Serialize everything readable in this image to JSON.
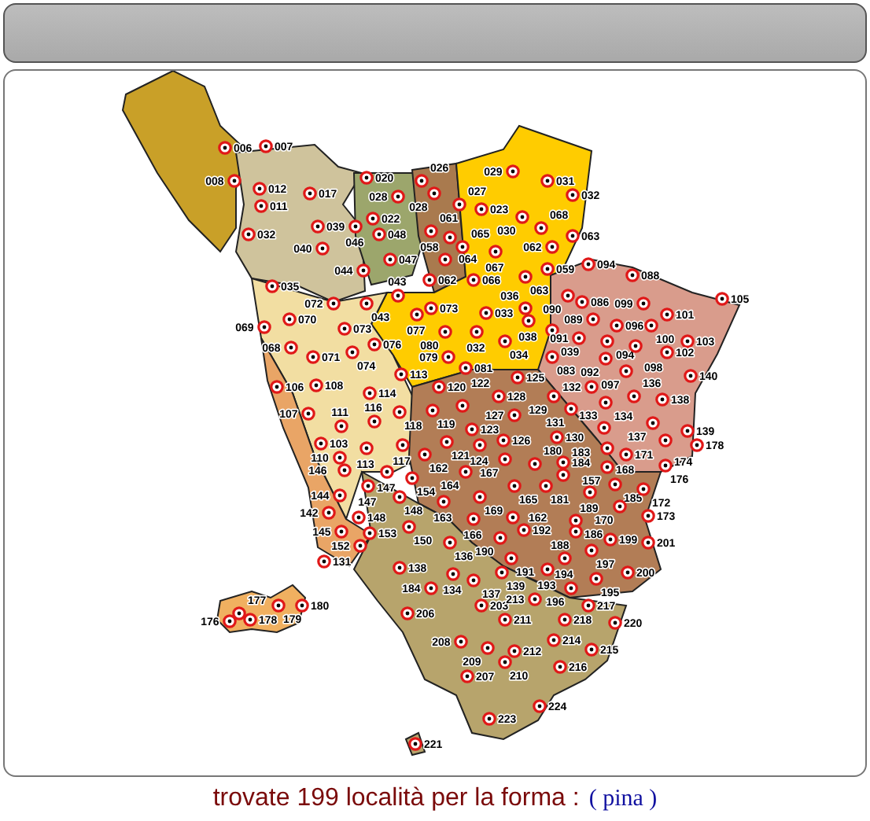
{
  "map": {
    "pins": [
      "006",
      "007",
      "029",
      "008",
      "020",
      "026",
      "031",
      "012",
      "017",
      "028",
      "028",
      "032",
      "011",
      "022",
      "027",
      "023",
      "030",
      "032",
      "039",
      "046",
      "048",
      "061",
      "068",
      "040",
      "064",
      "065",
      "062",
      "063",
      "047",
      "058",
      "067",
      "094",
      "044",
      "062",
      "066",
      "063",
      "059",
      "088",
      "035",
      "043",
      "090",
      "072",
      "043",
      "073",
      "033",
      "036",
      "086",
      "099",
      "105",
      "069",
      "070",
      "073",
      "077",
      "038",
      "089",
      "096",
      "100",
      "101",
      "076",
      "080",
      "032",
      "034",
      "039",
      "091",
      "094",
      "103",
      "068",
      "071",
      "074",
      "079",
      "083",
      "092",
      "098",
      "102",
      "113",
      "081",
      "097",
      "140",
      "106",
      "108",
      "120",
      "125",
      "132",
      "114",
      "122",
      "128",
      "129",
      "134",
      "136",
      "138",
      "107",
      "116",
      "118",
      "119",
      "127",
      "131",
      "137",
      "111",
      "123",
      "130",
      "133",
      "139",
      "103",
      "113",
      "117",
      "162",
      "121",
      "124",
      "126",
      "168",
      "171",
      "174",
      "178",
      "110",
      "146",
      "167",
      "180",
      "184",
      "157",
      "176",
      "147",
      "147",
      "154",
      "164",
      "165",
      "181",
      "183",
      "144",
      "148",
      "163",
      "169",
      "189",
      "185",
      "172",
      "142",
      "148",
      "162",
      "170",
      "173",
      "145",
      "153",
      "150",
      "166",
      "192",
      "186",
      "152",
      "136",
      "190",
      "188",
      "199",
      "201",
      "131",
      "191",
      "194",
      "197",
      "138",
      "134",
      "137",
      "139",
      "193",
      "195",
      "200",
      "184",
      "196",
      "176",
      "177",
      "178",
      "179",
      "180",
      "206",
      "203",
      "211",
      "213",
      "217",
      "218",
      "220",
      "208",
      "214",
      "209",
      "212",
      "215",
      "210",
      "216",
      "207",
      "224",
      "223",
      "221"
    ]
  },
  "footer": {
    "summary": "trovate 199 località per la forma :",
    "term": "( pina )"
  }
}
